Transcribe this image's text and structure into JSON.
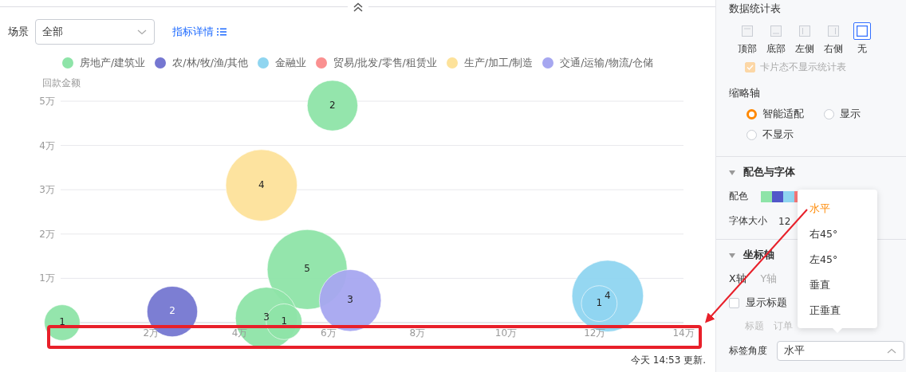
{
  "filter": {
    "label": "场景",
    "value": "全部"
  },
  "detail_link": "指标详情",
  "chart": {
    "chart_data": {
      "type": "scatter",
      "ylabel": "回款金额",
      "xlim": [
        0,
        14
      ],
      "ylim": [
        0,
        5
      ],
      "xticks": [
        {
          "value": 2,
          "label": "2万"
        },
        {
          "value": 4,
          "label": "4万"
        },
        {
          "value": 6,
          "label": "6万"
        },
        {
          "value": 8,
          "label": "8万"
        },
        {
          "value": 10,
          "label": "10万"
        },
        {
          "value": 12,
          "label": "12万"
        },
        {
          "value": 14,
          "label": "14万"
        }
      ],
      "yticks": [
        {
          "value": 1,
          "label": "1万"
        },
        {
          "value": 2,
          "label": "2万"
        },
        {
          "value": 3,
          "label": "3万"
        },
        {
          "value": 4,
          "label": "4万"
        },
        {
          "value": 5,
          "label": "5万"
        }
      ],
      "series": [
        {
          "name": "房地产/建筑业",
          "color": "#8ee4a8",
          "x": [
            0,
            4.6,
            5.52,
            5.0,
            6.09
          ],
          "values": [
            0,
            0.1,
            1.2,
            0.02,
            4.9
          ],
          "sizes": [
            1,
            3,
            5,
            1,
            2
          ],
          "value_labels": [
            "1",
            "3",
            "5",
            "1",
            "2"
          ]
        },
        {
          "name": "农/林/牧/渔/其他",
          "color": "#7577d1",
          "x": [
            2.48
          ],
          "values": [
            0.25
          ],
          "sizes": [
            2
          ],
          "value_labels": [
            "2"
          ]
        },
        {
          "name": "金融业",
          "color": "#8fd5f0",
          "x": [
            12.29,
            12.1
          ],
          "values": [
            0.6,
            0.43
          ],
          "sizes": [
            4,
            1
          ],
          "value_labels": [
            "4",
            "1"
          ]
        },
        {
          "name": "贸易/批发/零售/租赁业",
          "color": "#fa9090"
        },
        {
          "name": "生产/加工/制造",
          "color": "#fde29a",
          "x": [
            4.49
          ],
          "values": [
            3.1
          ],
          "sizes": [
            4
          ],
          "value_labels": [
            "4"
          ]
        },
        {
          "name": "交通/运输/物流/仓储",
          "color": "#a6a7f0",
          "x": [
            6.49
          ],
          "values": [
            0.5
          ],
          "sizes": [
            3
          ],
          "value_labels": [
            "3"
          ]
        }
      ],
      "grid": true
    }
  },
  "updated": "今天 14:53 更新.",
  "settings": {
    "stats_table": {
      "title": "数据统计表",
      "positions": [
        {
          "label": "顶部",
          "kind": "top",
          "selected": false
        },
        {
          "label": "底部",
          "kind": "bottom",
          "selected": false
        },
        {
          "label": "左侧",
          "kind": "left",
          "selected": false
        },
        {
          "label": "右侧",
          "kind": "right",
          "selected": false
        },
        {
          "label": "无",
          "kind": "none",
          "selected": true
        }
      ],
      "card_hide": {
        "label": "卡片态不显示统计表",
        "checked": true,
        "disabled": true
      }
    },
    "thumbnail_axis": {
      "title": "缩略轴",
      "options": [
        {
          "label": "智能适配",
          "selected": true
        },
        {
          "label": "显示",
          "selected": false
        },
        {
          "label": "不显示",
          "selected": false
        }
      ]
    },
    "color_font": {
      "title": "配色与字体",
      "expanded": true,
      "palette_label": "配色",
      "palette": [
        {
          "color": "#8ee4a8"
        },
        {
          "color": "#5257c9"
        },
        {
          "color": "#8fd5f0"
        },
        {
          "color": "#fa7a7a"
        }
      ],
      "font_size_label": "字体大小",
      "font_size": "12"
    },
    "axis": {
      "title": "坐标轴",
      "expanded": true,
      "tabs": [
        {
          "label": "X轴",
          "selected": true
        },
        {
          "label": "Y轴",
          "selected": false
        }
      ],
      "show_title": {
        "label": "显示标题",
        "checked": false
      },
      "title_label": "标题",
      "title_value": "订单",
      "label_angle": {
        "label": "标签角度",
        "value": "水平",
        "expanded": true
      }
    }
  },
  "angle_menu": [
    {
      "label": "水平",
      "selected": true
    },
    {
      "label": "右45°",
      "selected": false
    },
    {
      "label": "左45°",
      "selected": false
    },
    {
      "label": "垂直",
      "selected": false
    },
    {
      "label": "正垂直",
      "selected": false
    }
  ]
}
